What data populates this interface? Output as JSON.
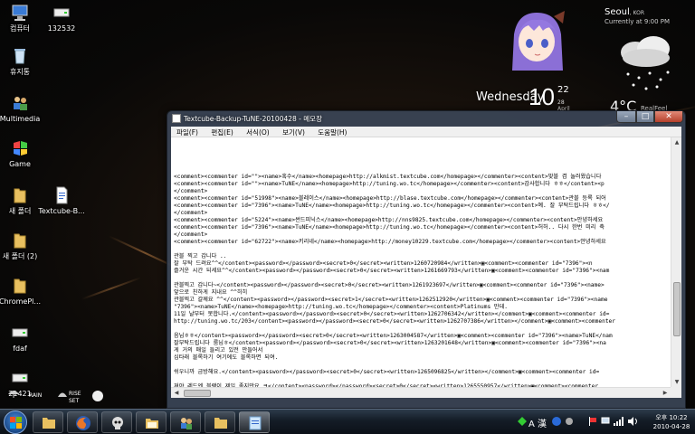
{
  "desktop": {
    "icons": [
      {
        "label": "컴퓨터",
        "icon": "computer-icon"
      },
      {
        "label": "132532",
        "icon": "drive-icon"
      },
      {
        "label": "휴지통",
        "icon": "recycle-bin-icon"
      },
      {
        "label": "Multimedia",
        "icon": "users-icon"
      },
      {
        "label": "Game",
        "icon": "game-icon"
      },
      {
        "label": "새 폴더",
        "icon": "folder-icon"
      },
      {
        "label": "Textcube-B...",
        "icon": "text-file-icon"
      },
      {
        "label": "새 폴더 (2)",
        "icon": "folder-icon"
      },
      {
        "label": "ChromePl...",
        "icon": "folder-icon"
      },
      {
        "label": "fdaf",
        "icon": "drive-icon"
      },
      {
        "label": "21421",
        "icon": "drive-icon"
      }
    ]
  },
  "clock_widget": {
    "day": "Wednesday",
    "hour": "10",
    "minute": "22",
    "date": "28 April"
  },
  "weather_widget": {
    "city": "Seoul",
    "country": ", KOR",
    "current_time": "Currently at 9:00 PM",
    "temp": "4°C",
    "realfeel": "RealFeel"
  },
  "bottom_widgets": {
    "rain": "RAIN",
    "rise": "RISE",
    "set": "SET"
  },
  "window": {
    "title": "Textcube-Backup-TuNE-20100428 - 메모장",
    "menu": [
      "파일(F)",
      "편집(E)",
      "서식(O)",
      "보기(V)",
      "도움말(H)"
    ],
    "lines": [
      "<comment><commenter id=\"\"><name>혹수</name><homepage>http://alkmist.textcube.com</homepage></commenter><content>맞블 겸 놀러왔습니다",
      "<comment><commenter id=\"\"><name>TuNE</name><homepage>http://tuning.wo.tc</homepage></commenter><content>감사합니다 ㅎㅎ</content><p",
      "</comment>",
      "<comment><commenter id=\"51998\"><name>블레이스</name><homepage>http://blase.textcube.com</homepage></commenter><content>관블 등록 되어",
      "<comment><commenter id=\"7396\"><name>TuNE</name><homepage>http://tuning.wo.tc</homepage></commenter><content>예. 잘 부탁드립니다 ㅎㅎ</",
      "</comment>",
      "<comment><commenter id=\"5224\"><name>썬드피닉스</name><homepage>http://nns9825.textcube.com</homepage></commenter><content>안녕하세요",
      "<comment><commenter id=\"7396\"><name>TuNE</name><homepage>http://tuning.wo.tc</homepage></commenter><content>허허.. 다시 한번 미리 축",
      "</comment>",
      "<comment><commenter id=\"62722\"><name>키리네</name><homepage>http://money10229.textcube.com</homepage></commenter><content>안녕하세요",
      "",
      "관블 찍고 갑니다 ..",
      "잘 부탁 드려요^^</content><password></password><secret>0</secret><written>1260720984</written>▣<comment><commenter id=\"7396\"><n",
      "즐거운 시간 되세요^^</content><password></password><secret>0</secret><written>1261669793</written>▣<comment><commenter id=\"7396\"><nam",
      "",
      "관블찍고 갑니다~</content><password></password><secret>0</secret><written>1261923697</written>▣<comment><commenter id=\"7396\"><name>",
      "앞으로 친하게 지내요 ^^히히",
      "관블찍고 갈께요 ^^</content><password></password><secret>1</secret><written>1262512920</written>▣<comment><commenter id=\"7396\"><name",
      "\"7396\"><name>TuNE</name><homepage>http://tuning.wo.tc</homepage></commenter><content>Platinums 만데.",
      "11일 날부터 못합니다.</content><password></password><secret>0</secret><written>1262706342</written></comment>▣<comment><commenter id=",
      "http://tuning.wo.tc/203</content><password></password><secret>0</secret><written>1262707386</written></comment>▣<comment><commenter",
      "",
      "음님ㅎㅎ</content><password></password><secret>0</secret><written>1263004587</written>▣<comment><commenter id=\"7396\"><name>TuNE</nam",
      "잘부탁드립니다 룸님ㅎ</content><password></password><secret>0</secret><written>1263201648</written>▣<comment><commenter id=\"7396\"><na",
      "게 거의 매일 들리고 있전 만들어서",
      "심타래 블록하기 여기에도 블록하면 되여.",
      "",
      "쉬우니까 금방해요.</content><password></password><secret>0</secret><written>1265096825</written></comment>▣<comment><commenter id=",
      "",
      "져야 레드엔 블랙이 제일 좋지만요 ㅋ</content><password></password><secret>0</secret><written>1265550957</written>▣<comment><commenter"
    ]
  },
  "taskbar": {
    "buttons": [
      "folder-icon",
      "firefox-icon",
      "skull-icon",
      "explorer-icon",
      "network-icon",
      "folder-icon",
      "notepad-icon"
    ],
    "lang": "A 漢",
    "time": "오후 10:22",
    "date": "2010-04-28"
  }
}
